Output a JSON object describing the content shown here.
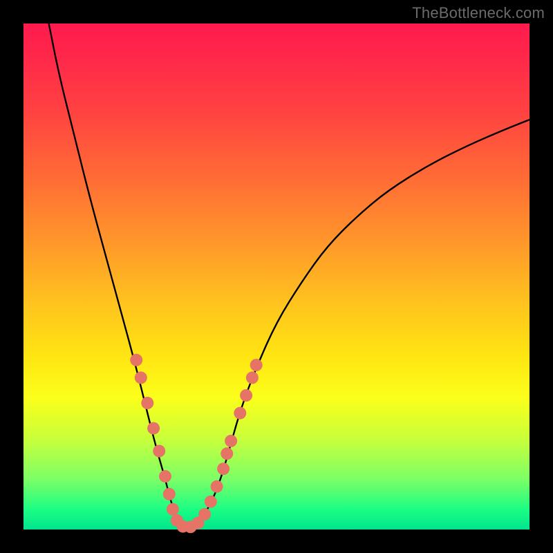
{
  "watermark": "TheBottleneck.com",
  "chart_data": {
    "type": "line",
    "title": "",
    "xlabel": "",
    "ylabel": "",
    "xlim": [
      0,
      100
    ],
    "ylim": [
      0,
      100
    ],
    "series": [
      {
        "name": "curve",
        "x": [
          5,
          7,
          10,
          13,
          16,
          19,
          22,
          24,
          26,
          28,
          29,
          30,
          31,
          32,
          33,
          35,
          37,
          39,
          41,
          43,
          46,
          50,
          55,
          60,
          66,
          72,
          80,
          88,
          95,
          100
        ],
        "y": [
          100,
          90,
          78,
          66,
          55,
          44,
          33,
          25,
          17,
          10,
          6,
          3,
          1,
          0,
          0.5,
          2,
          5,
          10,
          17,
          24,
          32,
          41,
          49,
          56,
          62,
          67,
          72,
          76,
          79,
          81
        ]
      }
    ],
    "markers": [
      {
        "x": 22.3,
        "y": 33.5
      },
      {
        "x": 23.2,
        "y": 30.0
      },
      {
        "x": 24.5,
        "y": 25.0
      },
      {
        "x": 25.7,
        "y": 20.0
      },
      {
        "x": 26.8,
        "y": 15.5
      },
      {
        "x": 28.0,
        "y": 10.5
      },
      {
        "x": 28.8,
        "y": 7.0
      },
      {
        "x": 29.5,
        "y": 4.0
      },
      {
        "x": 30.3,
        "y": 1.8
      },
      {
        "x": 31.5,
        "y": 0.6
      },
      {
        "x": 33.0,
        "y": 0.5
      },
      {
        "x": 34.5,
        "y": 1.3
      },
      {
        "x": 35.8,
        "y": 3.0
      },
      {
        "x": 37.0,
        "y": 5.5
      },
      {
        "x": 38.2,
        "y": 8.5
      },
      {
        "x": 39.5,
        "y": 12.0
      },
      {
        "x": 40.2,
        "y": 15.0
      },
      {
        "x": 41.0,
        "y": 17.5
      },
      {
        "x": 42.8,
        "y": 23.0
      },
      {
        "x": 44.0,
        "y": 26.5
      },
      {
        "x": 45.2,
        "y": 30.0
      },
      {
        "x": 46.0,
        "y": 32.5
      }
    ],
    "marker_color": "#e57366",
    "curve_color": "#000000"
  }
}
